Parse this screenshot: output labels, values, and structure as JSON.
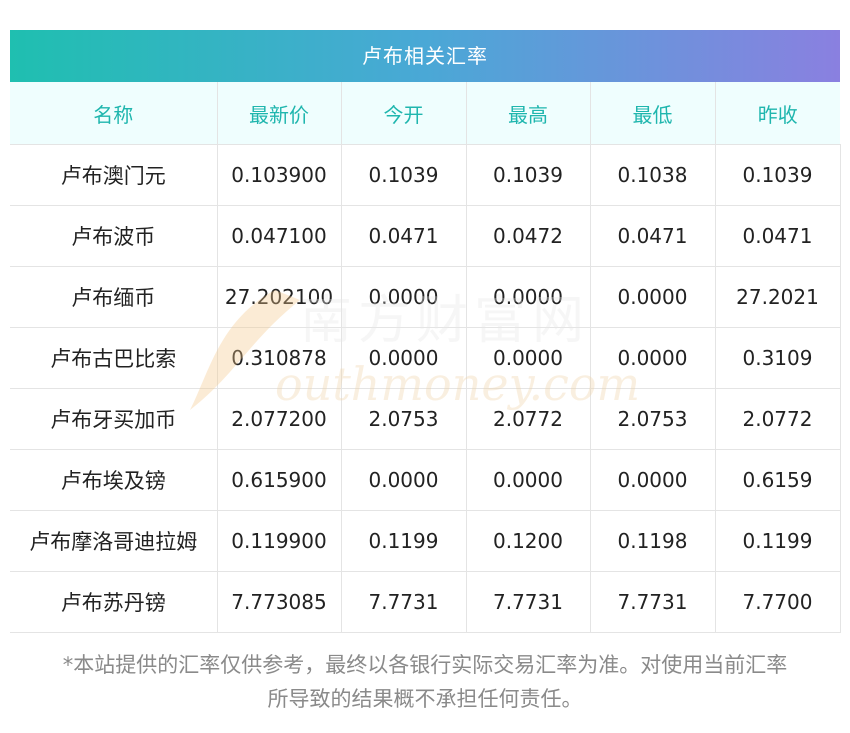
{
  "title": "卢布相关汇率",
  "columns": [
    "名称",
    "最新价",
    "今开",
    "最高",
    "最低",
    "昨收"
  ],
  "rows": [
    {
      "name": "卢布澳门元",
      "latest": "0.103900",
      "open": "0.1039",
      "high": "0.1039",
      "low": "0.1038",
      "prev_close": "0.1039"
    },
    {
      "name": "卢布波币",
      "latest": "0.047100",
      "open": "0.0471",
      "high": "0.0472",
      "low": "0.0471",
      "prev_close": "0.0471"
    },
    {
      "name": "卢布缅币",
      "latest": "27.202100",
      "open": "0.0000",
      "high": "0.0000",
      "low": "0.0000",
      "prev_close": "27.2021"
    },
    {
      "name": "卢布古巴比索",
      "latest": "0.310878",
      "open": "0.0000",
      "high": "0.0000",
      "low": "0.0000",
      "prev_close": "0.3109"
    },
    {
      "name": "卢布牙买加币",
      "latest": "2.077200",
      "open": "2.0753",
      "high": "2.0772",
      "low": "2.0753",
      "prev_close": "2.0772"
    },
    {
      "name": "卢布埃及镑",
      "latest": "0.615900",
      "open": "0.0000",
      "high": "0.0000",
      "low": "0.0000",
      "prev_close": "0.6159"
    },
    {
      "name": "卢布摩洛哥迪拉姆",
      "latest": "0.119900",
      "open": "0.1199",
      "high": "0.1200",
      "low": "0.1198",
      "prev_close": "0.1199"
    },
    {
      "name": "卢布苏丹镑",
      "latest": "7.773085",
      "open": "7.7731",
      "high": "7.7731",
      "low": "7.7731",
      "prev_close": "7.7700"
    }
  ],
  "watermark": {
    "cn": "南方财富网",
    "en": "outhmoney.com"
  },
  "disclaimer": {
    "line1": "*本站提供的汇率仅供参考，最终以各银行实际交易汇率为准。对使用当前汇率",
    "line2": "所导致的结果概不承担任何责任。"
  },
  "colors": {
    "gradient_start": "#1fbfb0",
    "gradient_end": "#8a80e0",
    "header_text": "#1fb6ae",
    "header_bg": "#effefe",
    "watermark": "#f5c88a"
  }
}
